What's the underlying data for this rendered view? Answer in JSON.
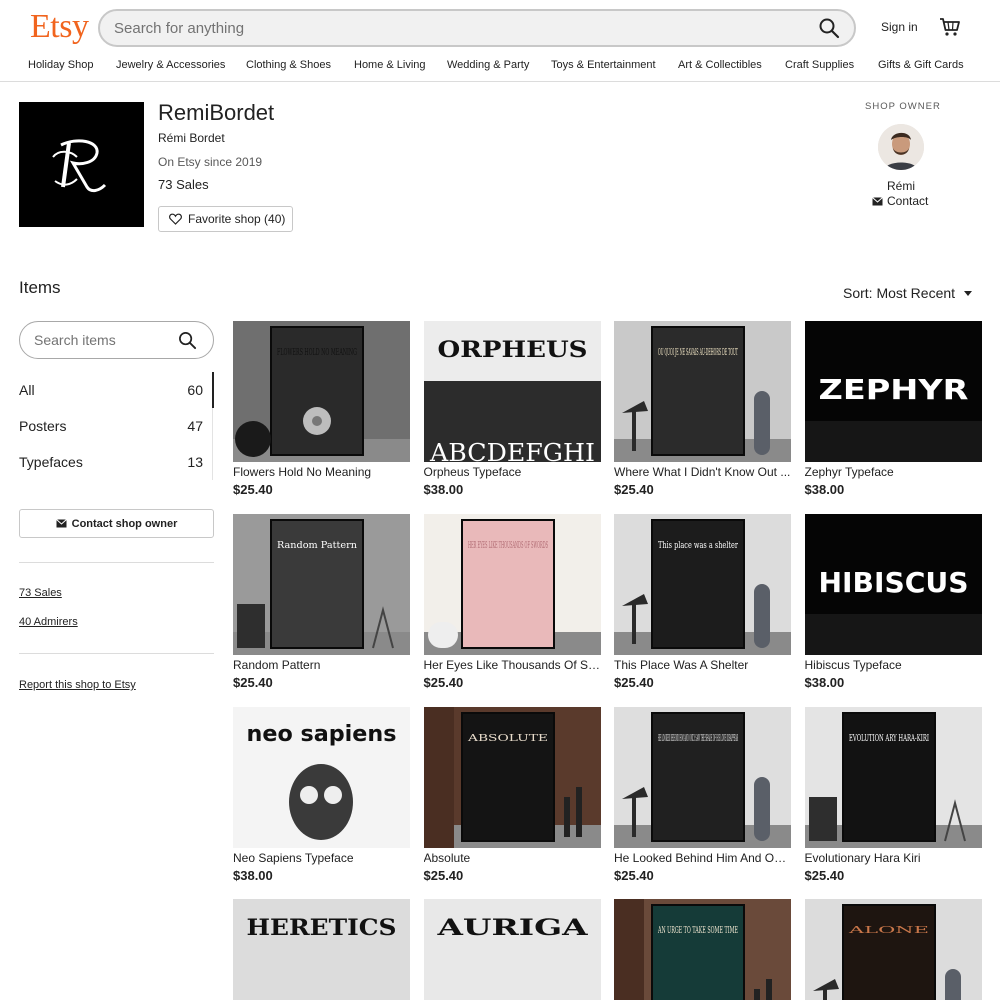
{
  "header": {
    "logo": "Etsy",
    "search_placeholder": "Search for anything",
    "sign_in": "Sign in"
  },
  "nav": [
    "Holiday Shop",
    "Jewelry & Accessories",
    "Clothing & Shoes",
    "Home & Living",
    "Wedding & Party",
    "Toys & Entertainment",
    "Art & Collectibles",
    "Craft Supplies",
    "Gifts & Gift Cards"
  ],
  "shop": {
    "name": "RemiBordet",
    "owner_full": "Rémi Bordet",
    "since": "On Etsy since 2019",
    "sales": "73 Sales",
    "favorite_label": "Favorite shop (40)",
    "owner_label": "SHOP OWNER",
    "owner_first": "Rémi",
    "contact_label": "Contact"
  },
  "items": {
    "heading": "Items",
    "sort_label": "Sort: Most Recent",
    "search_placeholder": "Search items"
  },
  "sections": [
    {
      "name": "All",
      "count": "60"
    },
    {
      "name": "Posters",
      "count": "47"
    },
    {
      "name": "Typefaces",
      "count": "13"
    }
  ],
  "sidebar": {
    "contact_owner": "Contact shop owner",
    "sales_link": "73 Sales",
    "admirers_link": "40 Admirers",
    "report_link": "Report this shop to Etsy"
  },
  "listings": [
    {
      "title": "Flowers Hold No Meaning",
      "price": "$25.40",
      "art": "FLOWERS HOLD NO MEANING",
      "bg": "#6f6f6f",
      "poster": "#2a2a2a",
      "ink": "#111111",
      "kind": "poster-room"
    },
    {
      "title": "Orpheus Typeface",
      "price": "$38.00",
      "art": "ORPHEUS",
      "art2": "ABCDEFGHI",
      "bg": "#ececec",
      "poster": "#ececec",
      "ink": "#111111",
      "kind": "type-serif"
    },
    {
      "title": "Where What I Didn't Know Out ...",
      "price": "$25.40",
      "art": "OU QUOI JE NE SAVAIS AU-DEHORS DE TOUT",
      "bg": "#c9c9c9",
      "poster": "#2b2b2b",
      "ink": "#f5e9c8",
      "kind": "poster-lamp"
    },
    {
      "title": "Zephyr Typeface",
      "price": "$38.00",
      "art": "ZEPHYR",
      "bg": "#050505",
      "poster": "#050505",
      "ink": "#ffffff",
      "kind": "type-display"
    },
    {
      "title": "Random Pattern",
      "price": "$25.40",
      "art": "Random Pattern",
      "bg": "#9a9a9a",
      "poster": "#3a3a3a",
      "ink": "#ffffff",
      "kind": "poster-letter"
    },
    {
      "title": "Her Eyes Like Thousands Of Sw...",
      "price": "$25.40",
      "art": "HER EYES LIKE THOUSANDS OF SWORDS",
      "bg": "#f2efea",
      "poster": "#e9b9ba",
      "ink": "#b06a72",
      "kind": "poster-pink"
    },
    {
      "title": "This Place Was A Shelter",
      "price": "$25.40",
      "art": "This place was a shelter",
      "bg": "#dcdcdc",
      "poster": "#1c1c1c",
      "ink": "#ffffff",
      "kind": "poster-lamp"
    },
    {
      "title": "Hibiscus Typeface",
      "price": "$38.00",
      "art": "HIBISCUS",
      "bg": "#050505",
      "poster": "#050505",
      "ink": "#ffffff",
      "kind": "type-display"
    },
    {
      "title": "Neo Sapiens Typeface",
      "price": "$38.00",
      "art": "neo sapiens",
      "bg": "#f4f4f4",
      "poster": "#f4f4f4",
      "ink": "#111111",
      "kind": "type-skull"
    },
    {
      "title": "Absolute",
      "price": "$25.40",
      "art": "ABSOLUTE",
      "bg": "#5a3a2c",
      "poster": "#141414",
      "ink": "#e8dccb",
      "kind": "poster-wood"
    },
    {
      "title": "He Looked Behind Him And Onl...",
      "price": "$25.40",
      "art": "HE LOOKED BEHIND HIM AND ONLY SAW THE SHADE OF HIS LOVE DISAPPEAR",
      "bg": "#dedede",
      "poster": "#202020",
      "ink": "#eeeeee",
      "kind": "poster-lamp"
    },
    {
      "title": "Evolutionary Hara Kiri",
      "price": "$25.40",
      "art": "EVOLUTION ARY HARA-KIRI",
      "bg": "#e4e4e4",
      "poster": "#121212",
      "ink": "#ffffff",
      "kind": "poster-letter"
    },
    {
      "title": "",
      "price": "",
      "art": "HERETICS",
      "bg": "#dcdcdc",
      "poster": "#dcdcdc",
      "ink": "#111111",
      "kind": "type-serif"
    },
    {
      "title": "",
      "price": "",
      "art": "AURIGA",
      "bg": "#e8e8e8",
      "poster": "#e8e8e8",
      "ink": "#111111",
      "kind": "type-serif"
    },
    {
      "title": "",
      "price": "",
      "art": "AN URGE TO TAKE SOME TIME",
      "bg": "#6a4a3a",
      "poster": "#153b38",
      "ink": "#f0e6d0",
      "kind": "poster-wood"
    },
    {
      "title": "",
      "price": "",
      "art": "ALONE",
      "bg": "#dcdcdc",
      "poster": "#1e1510",
      "ink": "#c9774a",
      "kind": "poster-lamp"
    }
  ]
}
